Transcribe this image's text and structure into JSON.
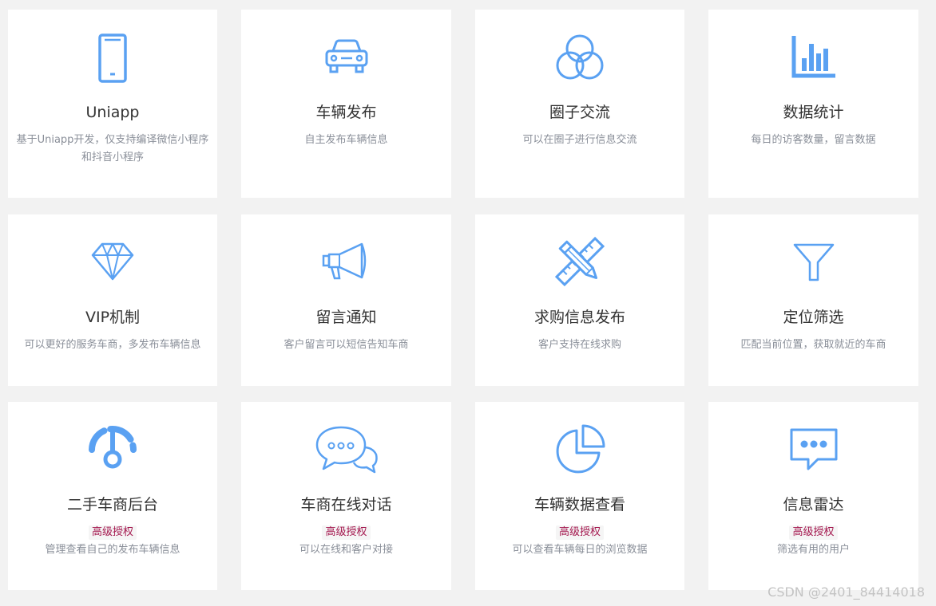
{
  "accent_color": "#5aa1f2",
  "badge_color": "#a4174e",
  "cards": [
    {
      "icon": "phone-icon",
      "title": "Uniapp",
      "desc": "基于Uniapp开发，仅支持编译微信小程序和抖音小程序"
    },
    {
      "icon": "car-icon",
      "title": "车辆发布",
      "desc": "自主发布车辆信息"
    },
    {
      "icon": "circles-icon",
      "title": "圈子交流",
      "desc": "可以在圈子进行信息交流"
    },
    {
      "icon": "bar-chart-icon",
      "title": "数据统计",
      "desc": "每日的访客数量，留言数据"
    },
    {
      "icon": "diamond-icon",
      "title": "VIP机制",
      "desc": "可以更好的服务车商，多发布车辆信息"
    },
    {
      "icon": "megaphone-icon",
      "title": "留言通知",
      "desc": "客户留言可以短信告知车商"
    },
    {
      "icon": "ruler-pencil-icon",
      "title": "求购信息发布",
      "desc": "客户支持在线求购"
    },
    {
      "icon": "filter-icon",
      "title": "定位筛选",
      "desc": "匹配当前位置，获取就近的车商"
    },
    {
      "icon": "dashboard-icon",
      "title": "二手车商后台",
      "badge": "高级授权",
      "desc": "管理查看自己的发布车辆信息"
    },
    {
      "icon": "chat-bubbles-icon",
      "title": "车商在线对话",
      "badge": "高级授权",
      "desc": "可以在线和客户对接"
    },
    {
      "icon": "pie-chart-icon",
      "title": "车辆数据查看",
      "badge": "高级授权",
      "desc": "可以查看车辆每日的浏览数据"
    },
    {
      "icon": "message-icon",
      "title": "信息雷达",
      "badge": "高级授权",
      "desc": "筛选有用的用户"
    }
  ],
  "watermark": "CSDN @2401_84414018"
}
